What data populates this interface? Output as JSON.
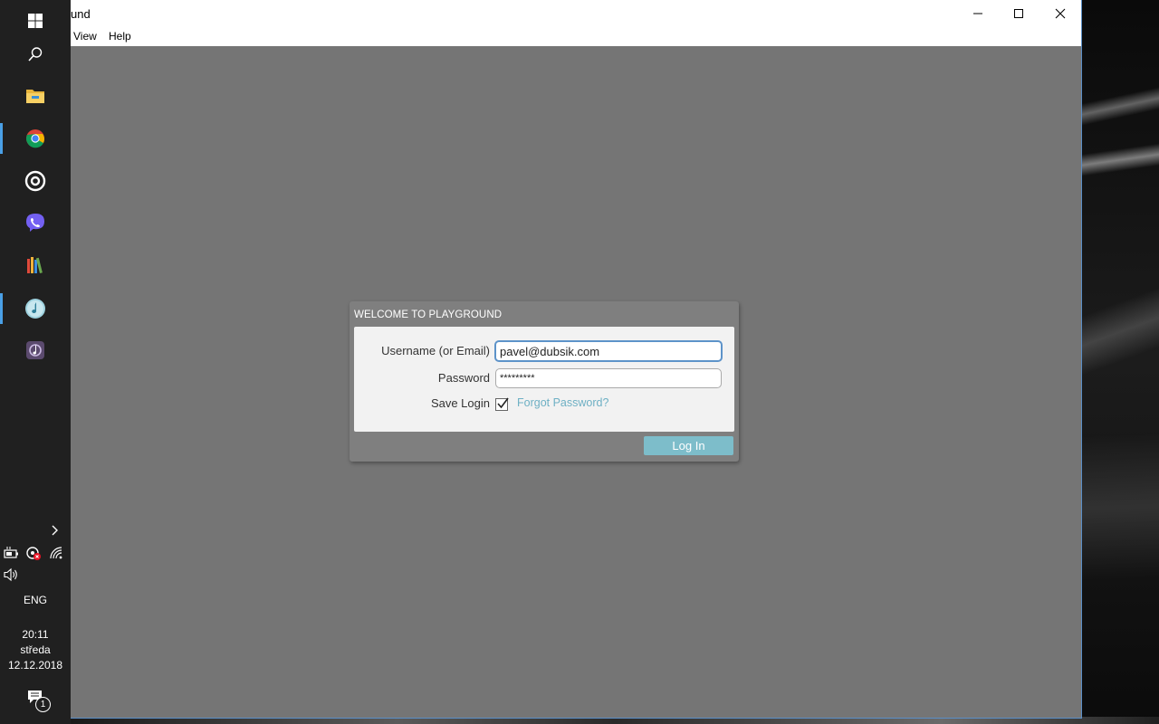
{
  "window": {
    "title": "und",
    "menu": [
      "View",
      "Help"
    ]
  },
  "dialog": {
    "title": "WELCOME TO PLAYGROUND",
    "username_label": "Username (or Email)",
    "username_value": "pavel@dubsik.com",
    "password_label": "Password",
    "password_value": "*********",
    "save_login_label": "Save Login",
    "save_login_checked": true,
    "forgot_password": "Forgot Password?",
    "login_button": "Log In"
  },
  "taskbar": {
    "apps": [
      "start-icon",
      "search-icon",
      "file-explorer-icon",
      "chrome-icon",
      "target-app-icon",
      "viber-icon",
      "library-icon",
      "music-app-icon",
      "media-app-icon"
    ],
    "language": "ENG",
    "time": "20:11",
    "day": "středa",
    "date": "12.12.2018",
    "notification_count": "1"
  },
  "colors": {
    "content_bg": "#757575",
    "dialog_bg": "#7f7f7f",
    "accent": "#7dbdca",
    "link": "#6eb0c4",
    "taskbar": "#202020"
  }
}
